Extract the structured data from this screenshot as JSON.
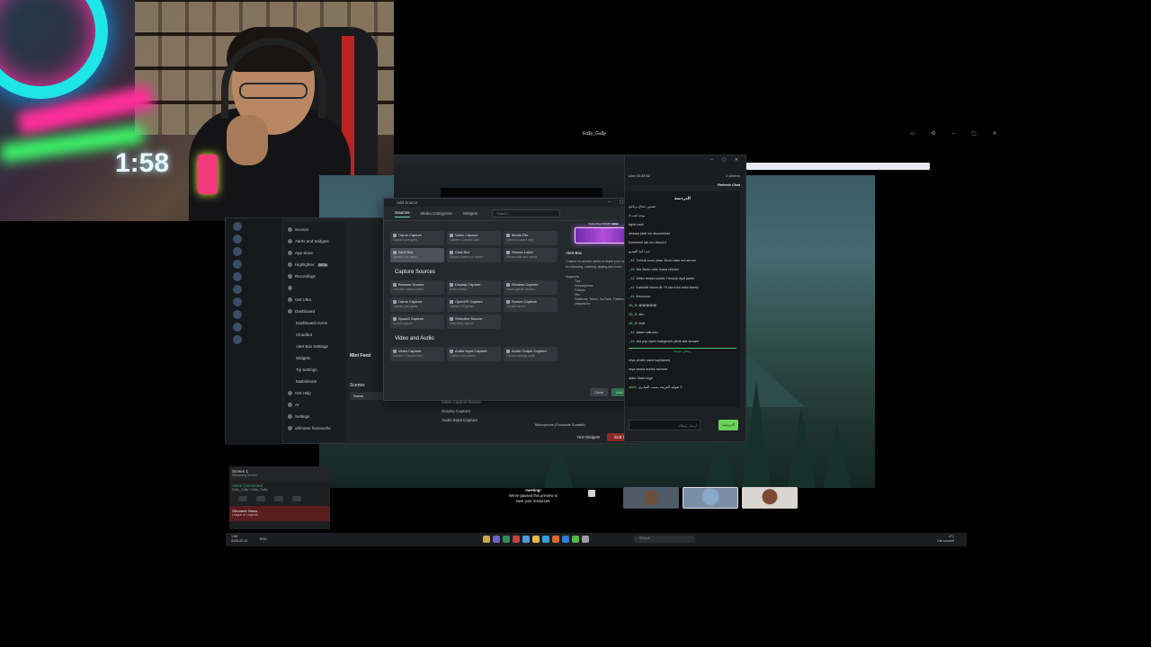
{
  "window": {
    "title": "Ea$y_Ga$y"
  },
  "dialog": {
    "title": "Add Source",
    "tabs": [
      "Sources",
      "Media Categories",
      "Widgets"
    ],
    "search_placeholder": "Search...",
    "sections": [
      {
        "title": "",
        "items": [
          {
            "name": "Game Capture",
            "desc": "Capture your game"
          },
          {
            "name": "Video Capture",
            "desc": "Camera / Capture Card"
          },
          {
            "name": "Media File",
            "desc": "Videos or sound clips"
          },
          {
            "name": "Alert Box",
            "desc": "Dynamic live alerts",
            "selected": true
          },
          {
            "name": "Chat Box",
            "desc": "Display chatters on screen"
          },
          {
            "name": "Stream Label",
            "desc": "Stream stats and events"
          }
        ]
      },
      {
        "title": "Capture Sources",
        "items": [
          {
            "name": "Browser Source",
            "desc": "Your web based content"
          },
          {
            "name": "Display Capture",
            "desc": "Entire monitor"
          },
          {
            "name": "Window Capture",
            "desc": "Share specific window"
          },
          {
            "name": "Game Capture",
            "desc": "Capture your game"
          },
          {
            "name": "OpenVR Capture",
            "desc": "Capture VR games"
          },
          {
            "name": "Screen Capture",
            "desc": "Capture screen"
          },
          {
            "name": "Spout2 Capture",
            "desc": "Spout2 support"
          },
          {
            "name": "Selective Source",
            "desc": "Selectively capture"
          }
        ]
      },
      {
        "title": "Video and Audio",
        "items": [
          {
            "name": "Video Capture",
            "desc": "Camera / Capture Card"
          },
          {
            "name": "Audio Input Capture",
            "desc": "Capture microphone"
          },
          {
            "name": "Audio Output Capture",
            "desc": "Capture desktop audio"
          }
        ]
      }
    ],
    "preview": {
      "banner_top": "Subscribed NAME! ■■■■",
      "banner_text": "hasSubscribed! ■■■",
      "title": "Alert Box",
      "description": "Custom on-screen alerts to thank your loyal viewers for following, subbing, tipping and more.",
      "supports_label": "Supports:",
      "supports": [
        "Tips",
        "Subscriptions",
        "Follows",
        "Hits",
        "Platforms: Twitch, YouTube, Facebook, Trovo & integrations"
      ]
    },
    "cancel": "Close",
    "add": "Add Source"
  },
  "app": {
    "sidebar": [
      {
        "label": "Scenes",
        "sub": false
      },
      {
        "label": "Alerts and Widgets",
        "sub": false
      },
      {
        "label": "App Store",
        "sub": false
      },
      {
        "label": "Highlighter",
        "sub": false,
        "badge": "BETA"
      },
      {
        "label": "Recordings",
        "sub": false
      },
      {
        "label": "",
        "sub": false
      },
      {
        "label": "Get Ultra",
        "sub": false
      },
      {
        "label": "Dashboard",
        "sub": false
      },
      {
        "label": "Dashboard Home",
        "sub": true
      },
      {
        "label": "Cloudbot",
        "sub": true
      },
      {
        "label": "Alert Box Settings",
        "sub": true
      },
      {
        "label": "Widgets",
        "sub": true
      },
      {
        "label": "Tip Settings",
        "sub": true
      },
      {
        "label": "Multistream",
        "sub": true
      },
      {
        "label": "Get Help",
        "sub": false
      },
      {
        "label": "AI",
        "sub": false
      },
      {
        "label": "Settings",
        "sub": false
      },
      {
        "label": "othmane hamouche",
        "sub": false
      }
    ],
    "mini_feed": "Mini Feed",
    "scenes_label": "Scenes",
    "scene_item": "Scene",
    "sources": [
      "Video Capture Device",
      "Display Capture",
      "Audio Input Capture"
    ],
    "mic_label": "Microphone (Focusrite Scarlett)",
    "test_widgets": "Test Widgets",
    "end_stream": "End Stream"
  },
  "chat": {
    "live": "Live 04:33:02",
    "viewers": "3 viewers",
    "refresh": "Refresh Chat",
    "room": "الدردشة",
    "messages": [
      {
        "user": "",
        "text": "شحني تحتاج برنامج"
      },
      {
        "user": "",
        "text": "بوحد لعب 4"
      },
      {
        "user": "",
        "text": "bghit nadi"
      },
      {
        "user": "",
        "text": "anasss jibtti mn discordddd"
      },
      {
        "user": "",
        "text": "Kanmmel lah mn discord"
      },
      {
        "user": "",
        "text": "جيب لينا الفيديو"
      },
      {
        "user": "_44:",
        "text": "Yoholk zone yban 3ledo rabk mn server"
      },
      {
        "user": "_44:",
        "text": "Wa 3ledo rabk howa chkilan"
      },
      {
        "user": "_44:",
        "text": "Wilkn berjda kaafer f leouyk dyal jambi"
      },
      {
        "user": "_44:",
        "text": "Kateddil follow llir 7it nta m3a arika family"
      },
      {
        "user": "_44:",
        "text": "Amoooon"
      },
      {
        "user": "0B_B:",
        "text": "😀😀😀😀😀"
      },
      {
        "user": "0B_B:",
        "text": "alm"
      },
      {
        "user": "0B_B:",
        "text": "fesil"
      },
      {
        "user": "_44:",
        "text": "salam alikoom"
      },
      {
        "user": "_44:",
        "text": "dra pop dyeb mabghach ytteli dak stream"
      }
    ],
    "divider": "رسائل جديدة",
    "after": [
      {
        "user": "",
        "text": "reya andek saed kay3awed"
      },
      {
        "user": "",
        "text": "reya sawla andek alchwer"
      },
      {
        "user": "",
        "text": "aldiv: Mark tagh"
      },
      {
        "user": "abdo:",
        "text": "لا تقوليه الفريقة بسبب الصابري"
      }
    ],
    "input_placeholder": "أرسل رسالة...",
    "send": "الدردشة"
  },
  "discord": {
    "screen_title": "Screen 1",
    "screen_sub": "Streaming Screen",
    "voice_title": "Voice Connected",
    "voice_sub": "Ea$y_Ga$y / Ea$y_Ga$y",
    "user_name": "Othmane Hamo...",
    "user_sub": "League of Legends"
  },
  "call": {
    "line1": "meeting!",
    "line2": "We've paused this preview to",
    "line3": "save your resources."
  },
  "taskbar": {
    "time": "1:58",
    "date": "2026-02-10",
    "lang": "ENG",
    "search_placeholder": "Search",
    "weather_temp": "4°C",
    "weather_desc": "Ciel couvert"
  },
  "colors": {
    "accent": "#6cd29a",
    "end_stream": "#8c2a2a",
    "chat_user": "#67d88a"
  }
}
